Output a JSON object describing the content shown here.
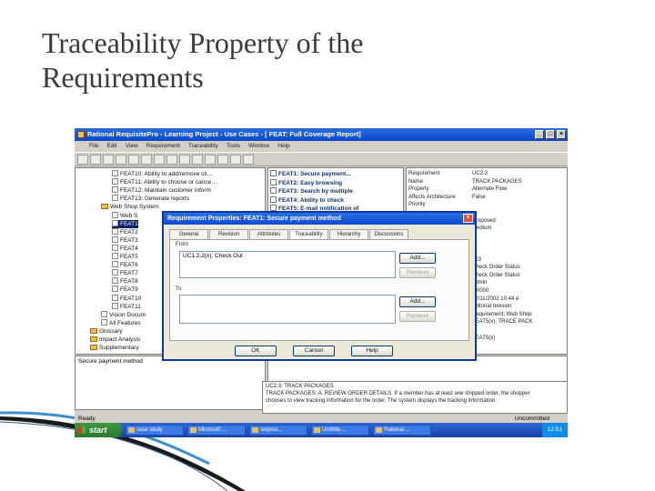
{
  "slide": {
    "title_line1": "Traceability Property of the",
    "title_line2": "Requirements"
  },
  "window": {
    "title": "Rational RequisitePro - Learning Project - Use Cases - [ FEAT: Full Coverage Report]"
  },
  "menu": [
    "File",
    "Edit",
    "View",
    "Requirement",
    "Traceability",
    "Tools",
    "Window",
    "Help"
  ],
  "tree": [
    {
      "label": "FEAT10: Ability to add/remove cli…",
      "indent": 3
    },
    {
      "label": "FEAT11: Ability to choose or cance…",
      "indent": 3
    },
    {
      "label": "FEAT12: Maintain customer inform",
      "indent": 3
    },
    {
      "label": "FEAT13: Generate reports",
      "indent": 3
    },
    {
      "label": "Web Shop System",
      "indent": 2,
      "folder": true
    },
    {
      "label": "Web S",
      "indent": 3
    },
    {
      "label": "FEAT1",
      "indent": 3,
      "selected": true
    },
    {
      "label": "FEAT2",
      "indent": 3
    },
    {
      "label": "FEAT3",
      "indent": 3
    },
    {
      "label": "FEAT4",
      "indent": 3
    },
    {
      "label": "FEAT5",
      "indent": 3
    },
    {
      "label": "FEAT6",
      "indent": 3
    },
    {
      "label": "FEAT7",
      "indent": 3
    },
    {
      "label": "FEAT8",
      "indent": 3
    },
    {
      "label": "FEAT9",
      "indent": 3
    },
    {
      "label": "FEAT10",
      "indent": 3
    },
    {
      "label": "FEAT11",
      "indent": 3
    },
    {
      "label": "Vision Docum",
      "indent": 2
    },
    {
      "label": "All Features",
      "indent": 2
    },
    {
      "label": "Glossary",
      "indent": 1,
      "folder": true
    },
    {
      "label": "Impact Analysis",
      "indent": 1,
      "folder": true
    },
    {
      "label": "Supplementary",
      "indent": 1,
      "folder": true
    }
  ],
  "description": "Secure payment method",
  "list": [
    "FEAT1: Secure payment...",
    "FEAT2: Easy browsing",
    "FEAT3: Search by multiple",
    "FEAT4: Ability to check",
    "FEAT5: E-mail notification of"
  ],
  "attributes": [
    {
      "k": "Requirement",
      "v": "UC2.3"
    },
    {
      "k": "Name",
      "v": "TRACK PACKAGES"
    },
    {
      "k": "Property",
      "v": "Alternate Flow"
    },
    {
      "k": "Affects Architecture",
      "v": "False"
    },
    {
      "k": "Priority",
      "v": ""
    },
    {
      "k": "",
      "v": ""
    },
    {
      "k": "",
      "v": "Proposed"
    },
    {
      "k": "",
      "v": "Medium"
    },
    {
      "k": "",
      "v": ""
    },
    {
      "k": "",
      "v": ""
    },
    {
      "k": "",
      "v": ""
    },
    {
      "k": "",
      "v": "323"
    },
    {
      "k": "",
      "v": "Check Order Status"
    },
    {
      "k": "",
      "v": "Check Order Status"
    },
    {
      "k": "",
      "v": "admin"
    },
    {
      "k": "",
      "v": "1.0000"
    },
    {
      "k": "",
      "v": "12/11/2002 10:44 e"
    },
    {
      "k": "",
      "v": "editorial revision"
    },
    {
      "k": "",
      "v": "Requirement: Web Shop"
    },
    {
      "k": "",
      "v": "FEAT5(x), TRACE PACK"
    },
    {
      "k": "",
      "v": ""
    },
    {
      "k": "",
      "v": "FEAT5(x)"
    },
    {
      "k": "",
      "v": "2"
    }
  ],
  "bottom_text": [
    "UC2.3: TRACK PACKAGES",
    "TRACK PACKAGES: A. REVIEW ORDER DETAILS. If a member has at least one shipped order, the shopper",
    "chooses to view tracking information for the order. The system displays the tracking information."
  ],
  "status": {
    "left": "Ready",
    "right": "Uncommitted"
  },
  "dialog": {
    "title": "Requirement Properties: FEAT1: Secure payment method",
    "tabs": [
      "General",
      "Revision",
      "Attributes",
      "Traceability",
      "Hierarchy",
      "Discussions"
    ],
    "active_tab": 3,
    "from_label": "From",
    "from_value": "UC1.2.2(x): Check Out",
    "to_label": "To",
    "to_value": "",
    "add_label": "Add...",
    "remove_label": "Remove",
    "ok": "OK",
    "cancel": "Cancel",
    "help": "Help"
  },
  "taskbar": {
    "start": "start",
    "tasks": [
      "case study",
      "Microsoft ...",
      "seqnce...",
      "Undtitle...",
      "Rational ..."
    ],
    "tray": "12:51"
  }
}
